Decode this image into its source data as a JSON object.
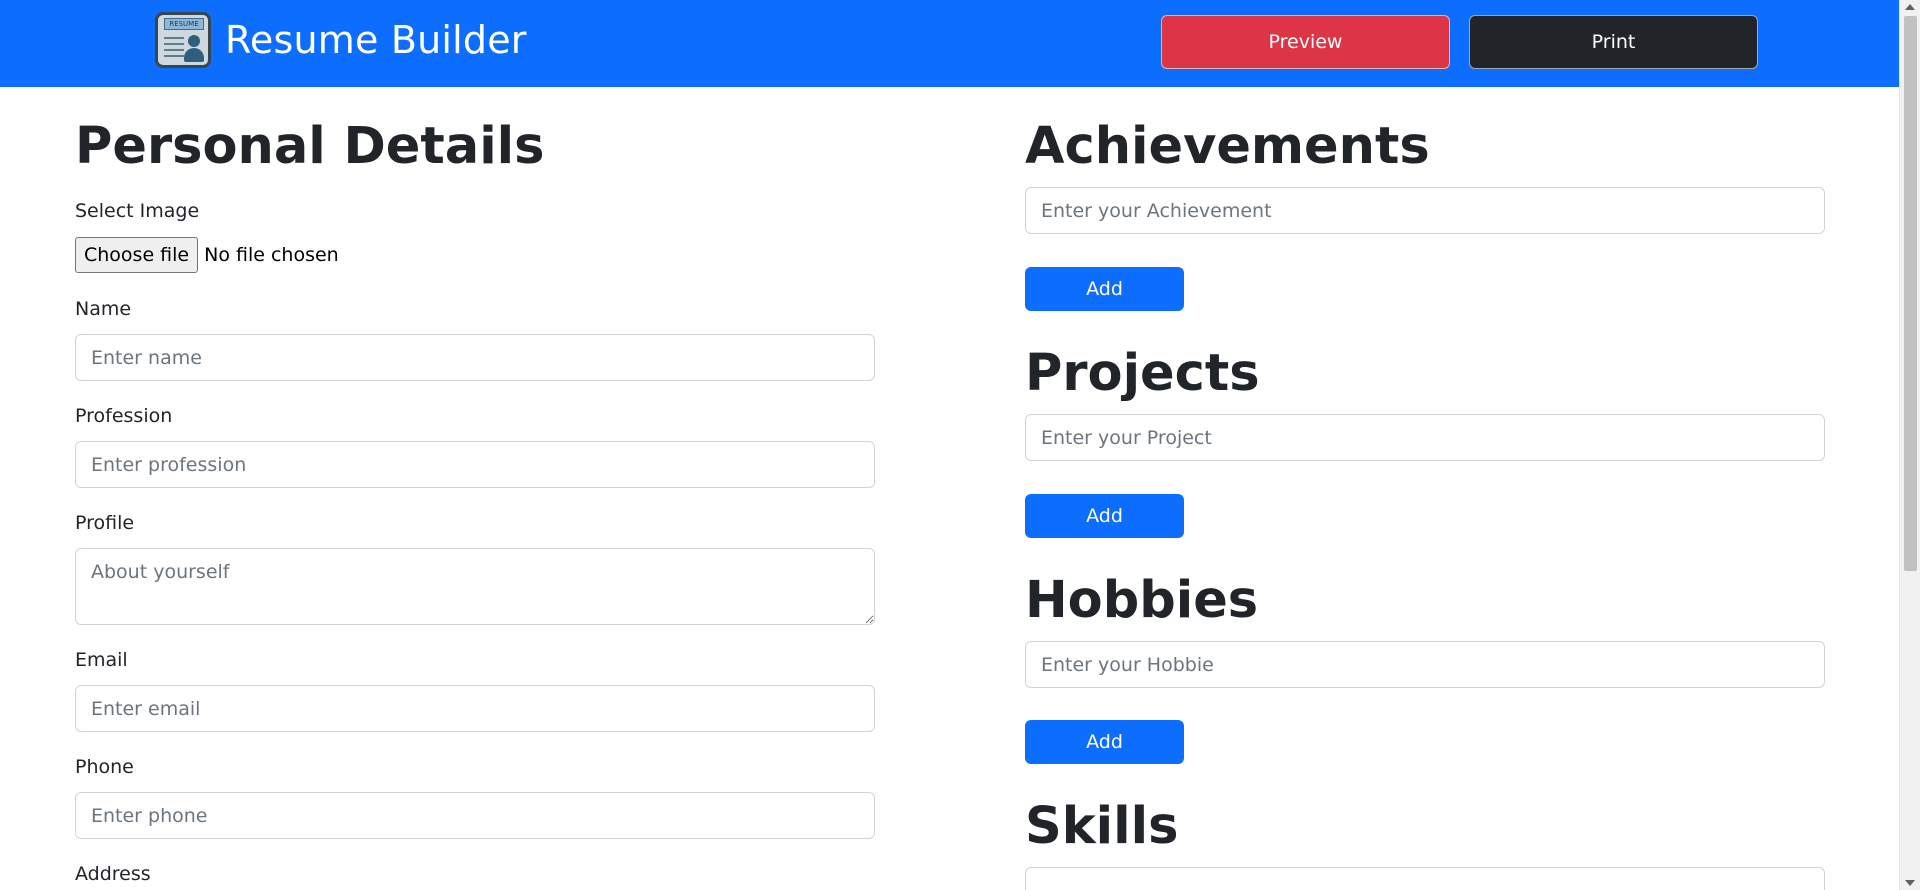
{
  "app": {
    "title": "Resume Builder",
    "logo_text": "RESUME"
  },
  "nav": {
    "preview_label": "Preview",
    "print_label": "Print"
  },
  "personal": {
    "heading": "Personal Details",
    "image_label": "Select Image",
    "file_button": "Choose file",
    "file_status": "No file chosen",
    "name_label": "Name",
    "name_placeholder": "Enter name",
    "profession_label": "Profession",
    "profession_placeholder": "Enter profession",
    "profile_label": "Profile",
    "profile_placeholder": "About yourself",
    "email_label": "Email",
    "email_placeholder": "Enter email",
    "phone_label": "Phone",
    "phone_placeholder": "Enter phone",
    "address_label": "Address"
  },
  "achievements": {
    "heading": "Achievements",
    "placeholder": "Enter your Achievement",
    "add_label": "Add"
  },
  "projects": {
    "heading": "Projects",
    "placeholder": "Enter your Project",
    "add_label": "Add"
  },
  "hobbies": {
    "heading": "Hobbies",
    "placeholder": "Enter your Hobbie",
    "add_label": "Add"
  },
  "skills": {
    "heading": "Skills"
  },
  "colors": {
    "primary": "#0d6efd",
    "danger": "#dc3545",
    "dark": "#212529"
  }
}
